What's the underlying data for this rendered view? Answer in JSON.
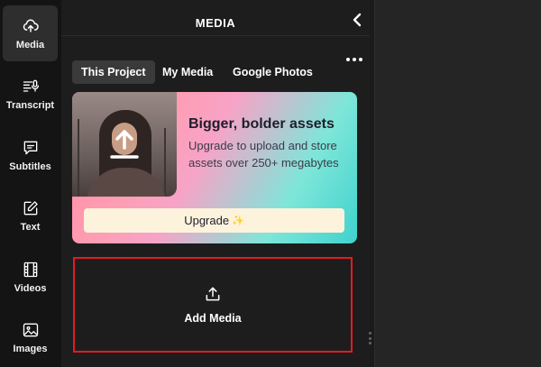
{
  "sidebar": {
    "items": [
      {
        "label": "Media",
        "icon": "upload-cloud-icon",
        "active": true
      },
      {
        "label": "Transcript",
        "icon": "transcript-icon",
        "active": false
      },
      {
        "label": "Subtitles",
        "icon": "subtitles-icon",
        "active": false
      },
      {
        "label": "Text",
        "icon": "text-edit-icon",
        "active": false
      },
      {
        "label": "Videos",
        "icon": "film-icon",
        "active": false
      },
      {
        "label": "Images",
        "icon": "image-icon",
        "active": false
      }
    ]
  },
  "panel": {
    "title": "MEDIA",
    "collapse_icon": "chevron-left-icon",
    "more_icon": "more-horizontal-icon",
    "tabs": [
      {
        "label": "This Project",
        "active": true
      },
      {
        "label": "My Media",
        "active": false
      },
      {
        "label": "Google Photos",
        "active": false
      }
    ],
    "promo": {
      "heading": "Bigger, bolder assets",
      "body": "Upgrade to upload and store assets over 250+ megabytes",
      "button_label": "Upgrade",
      "sparkle": "✨"
    },
    "add_media": {
      "label": "Add Media",
      "icon": "upload-icon"
    }
  },
  "colors": {
    "highlight_border": "#e31b23",
    "panel_bg": "#1d1d1d",
    "rail_bg": "#141414"
  }
}
